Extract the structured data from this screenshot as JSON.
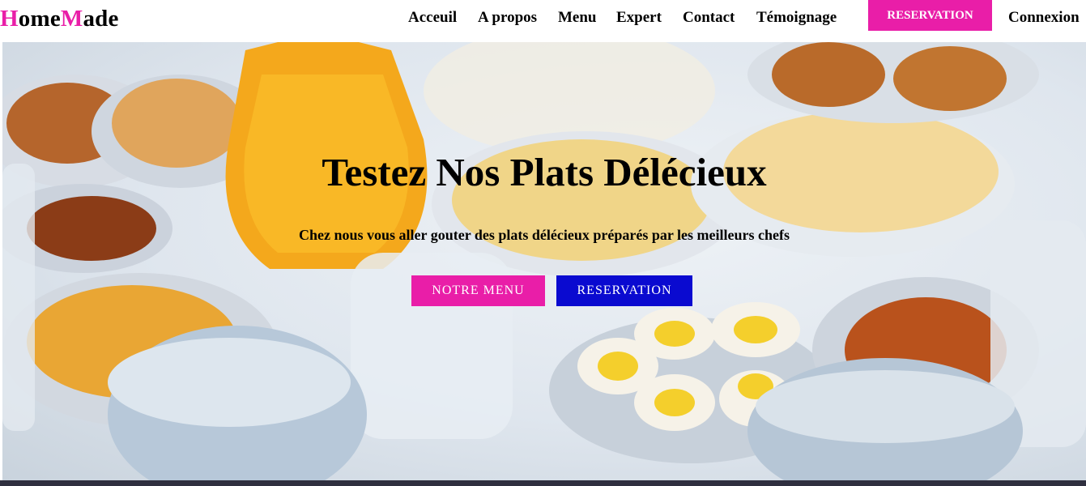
{
  "brand": {
    "first_initial": "H",
    "first_rest": "ome",
    "second_initial": "M",
    "second_rest": "ade",
    "accent_color": "#e91ea8"
  },
  "nav": {
    "items": [
      "Acceuil",
      "A propos",
      "Menu",
      "Expert",
      "Contact",
      "Témoignage"
    ],
    "reservation_label": "RESERVATION",
    "login_label": "Connexion"
  },
  "hero": {
    "title": "Testez Nos Plats Délécieux",
    "subtitle": "Chez nous vous aller gouter des plats délécieux préparés par les meilleurs chefs",
    "primary_button": "NOTRE MENU",
    "secondary_button": "RESERVATION",
    "primary_color": "#e91ea8",
    "secondary_color": "#0a0ad0",
    "background_image": "moroccan-breakfast-table-photo"
  }
}
